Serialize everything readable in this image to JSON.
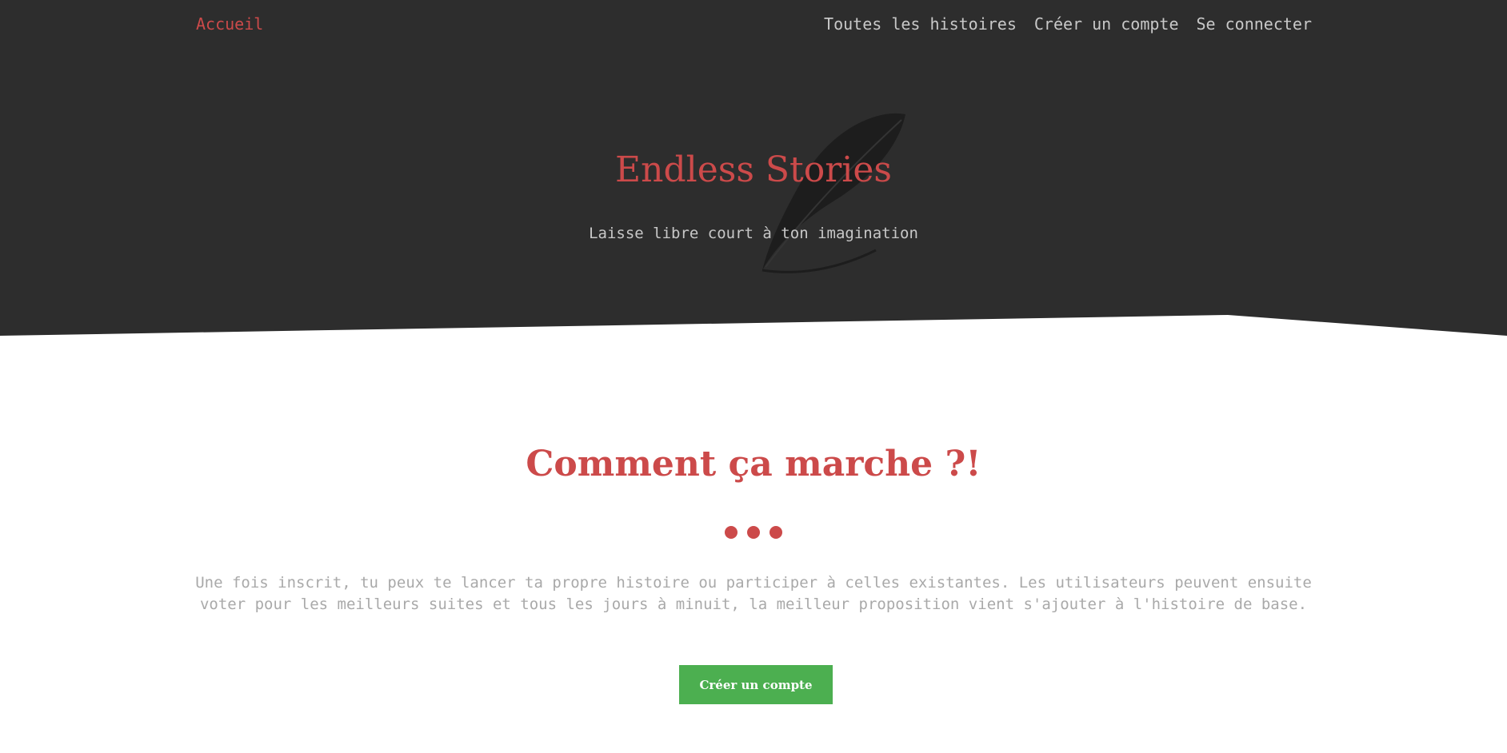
{
  "nav": {
    "home": "Accueil",
    "all_stories": "Toutes les histoires",
    "create_account": "Créer un compte",
    "login": "Se connecter"
  },
  "hero": {
    "title": "Endless Stories",
    "subtitle": "Laisse libre court à ton imagination",
    "icon": "feather-icon"
  },
  "how_it_works": {
    "title": "Comment ça marche ?!",
    "description": "Une fois inscrit, tu peux te lancer ta propre histoire ou participer à celles existantes. Les utilisateurs peuvent ensuite voter pour les meilleurs suites et tous les jours à minuit, la meilleur proposition vient s'ajouter à l'histoire de base.",
    "cta_label": "Créer un compte"
  },
  "colors": {
    "hero_bg": "#2d2d2d",
    "accent": "#cc4a4a",
    "nav_text": "#c8c8c8",
    "body_text": "#a9a9a9",
    "button": "#4caf50"
  }
}
